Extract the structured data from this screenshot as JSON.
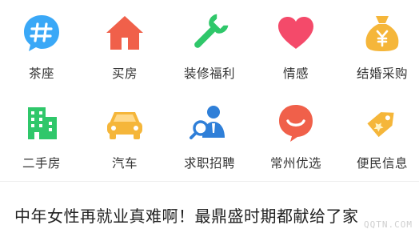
{
  "grid": {
    "row1": [
      {
        "label": "茶座",
        "icon": "hash-chat-bubble-icon",
        "color": "#3aa8f7"
      },
      {
        "label": "买房",
        "icon": "house-icon",
        "color": "#f0604a"
      },
      {
        "label": "装修福利",
        "icon": "wrench-icon",
        "color": "#2fc76a"
      },
      {
        "label": "情感",
        "icon": "heart-icon",
        "color": "#f44a6a"
      },
      {
        "label": "结婚采购",
        "icon": "money-bag-icon",
        "color": "#f5b63a"
      }
    ],
    "row2": [
      {
        "label": "二手房",
        "icon": "building-icon",
        "color": "#2fc76a"
      },
      {
        "label": "汽车",
        "icon": "car-icon",
        "color": "#f5b63a"
      },
      {
        "label": "求职招聘",
        "icon": "job-search-icon",
        "color": "#2f7fd8"
      },
      {
        "label": "常州优选",
        "icon": "smile-bubble-icon",
        "color": "#f0604a"
      },
      {
        "label": "便民信息",
        "icon": "price-tag-icon",
        "color": "#f5b63a"
      }
    ]
  },
  "feed": {
    "headline": "中年女性再就业真难啊！最鼎盛时期都献给了家"
  },
  "watermark": "QQTN.COM"
}
